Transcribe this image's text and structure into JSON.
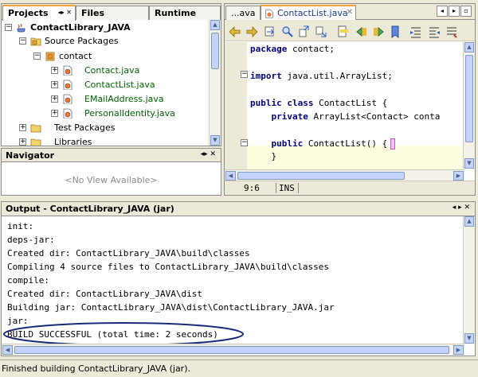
{
  "projects_panel": {
    "tabs": [
      {
        "label": "Projects"
      },
      {
        "label": "Files"
      },
      {
        "label": "Runtime"
      }
    ],
    "tree": [
      {
        "label": "ContactLibrary_JAVA"
      },
      {
        "label": "Source Packages"
      },
      {
        "label": "contact"
      },
      {
        "label": "Contact.java"
      },
      {
        "label": "ContactList.java"
      },
      {
        "label": "EMailAddress.java"
      },
      {
        "label": "PersonalIdentity.java"
      },
      {
        "label": "Test Packages"
      },
      {
        "label": "Libraries"
      }
    ],
    "tab_controls": "◂ ▸ ×"
  },
  "navigator_panel": {
    "title": "Navigator",
    "empty_text": "<No View Available>"
  },
  "editor": {
    "tabs": [
      {
        "label": "...ava"
      },
      {
        "label": "ContactList.java"
      }
    ],
    "code_lines": [
      {
        "kw": "package",
        "rest": " contact;"
      },
      {
        "kw": "",
        "rest": ""
      },
      {
        "kw": "import",
        "rest": " java.util.ArrayList;"
      },
      {
        "kw": "",
        "rest": ""
      },
      {
        "kw": "public class",
        "rest": " ContactList {"
      },
      {
        "kw": "    private",
        "rest": " ArrayList<Contact> conta"
      },
      {
        "kw": "",
        "rest": ""
      },
      {
        "kw": "    public",
        "rest": " ContactList() {"
      },
      {
        "kw": "",
        "rest": "    }"
      }
    ],
    "cursor_position": "9:6",
    "insert_mode": "INS"
  },
  "output_panel": {
    "title": "Output - ContactLibrary_JAVA (jar)",
    "lines": [
      "init:",
      "deps-jar:",
      "Created dir: ContactLibrary_JAVA\\build\\classes",
      "Compiling 4 source files to ContactLibrary_JAVA\\build\\classes",
      "compile:",
      "Created dir: ContactLibrary_JAVA\\dist",
      "Building jar: ContactLibrary_JAVA\\dist\\ContactLibrary_JAVA.jar",
      "jar:",
      "BUILD SUCCESSFUL (total time: 2 seconds)"
    ]
  },
  "status_bar": {
    "text": "Finished building ContactLibrary_JAVA (jar)."
  },
  "colors": {
    "window_bg": "#ece9d8",
    "active_tab_accent": "#f3a33b",
    "java_file_text": "#006400",
    "keyword": "#000080",
    "highlight_line": "#fdfde0",
    "ellipse": "#1b2a7a"
  }
}
